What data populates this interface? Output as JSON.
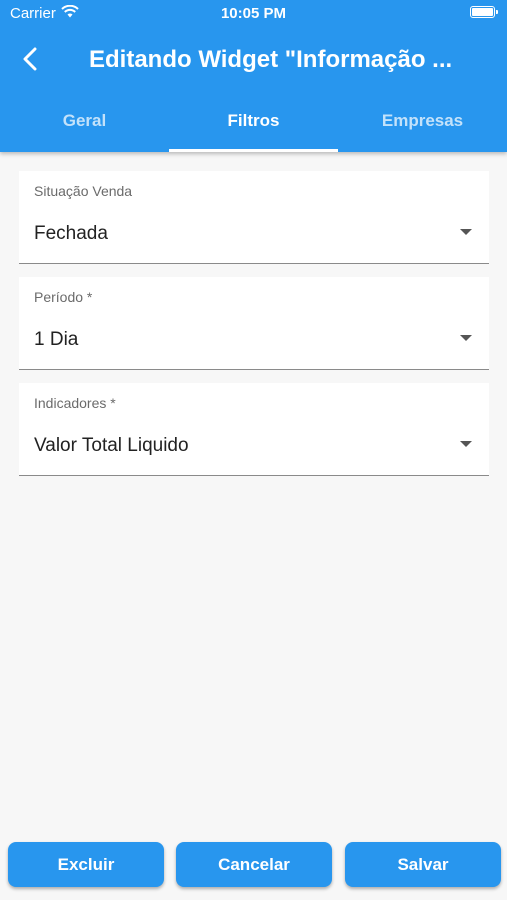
{
  "status_bar": {
    "carrier": "Carrier",
    "time": "10:05 PM",
    "wifi_icon": "wifi-icon",
    "battery_icon": "battery-icon"
  },
  "header": {
    "back_icon": "chevron-left-icon",
    "title": "Editando Widget \"Informação ...",
    "background_color": "#2896ee"
  },
  "tabs": [
    {
      "label": "Geral",
      "active": false
    },
    {
      "label": "Filtros",
      "active": true
    },
    {
      "label": "Empresas",
      "active": false
    }
  ],
  "fields": [
    {
      "label": "Situação Venda",
      "value": "Fechada",
      "icon": "dropdown-arrow-icon"
    },
    {
      "label": "Período *",
      "value": "1 Dia",
      "icon": "dropdown-arrow-icon"
    },
    {
      "label": "Indicadores *",
      "value": "Valor Total Liquido",
      "icon": "dropdown-arrow-icon"
    }
  ],
  "actions": {
    "delete_label": "Excluir",
    "cancel_label": "Cancelar",
    "save_label": "Salvar"
  }
}
